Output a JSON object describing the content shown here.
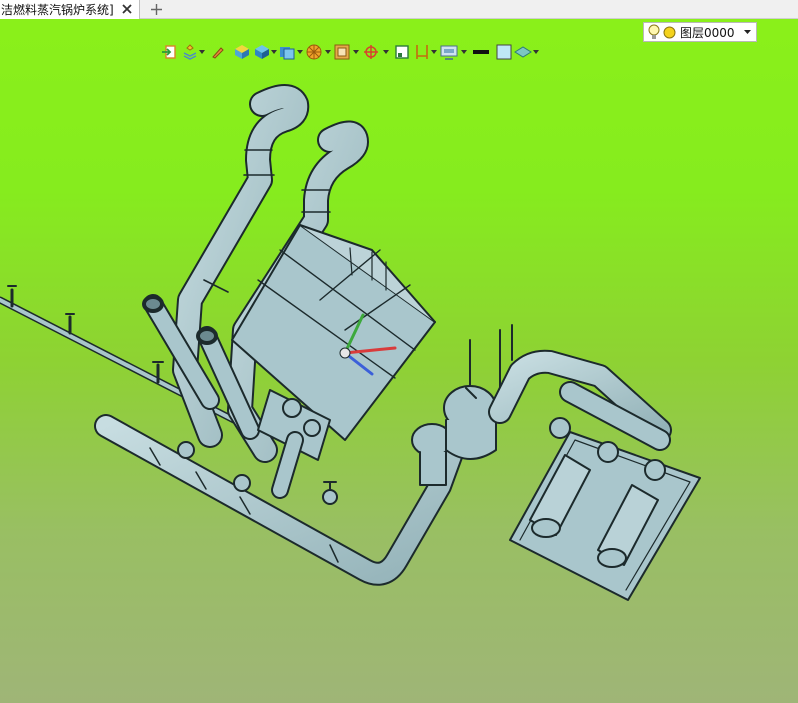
{
  "tab": {
    "title": "洁燃料蒸汽锅炉系统]",
    "close_icon": "close-icon",
    "add_icon": "plus-icon"
  },
  "toolbar": {
    "items": [
      "exit-icon",
      "layer-tools-icon",
      "pencil-icon",
      "material-icon",
      "cube-icon",
      "solid-view-icon",
      "render-icon",
      "box-frame-icon",
      "axis-icon",
      "select-box-icon",
      "dimension-icon",
      "display-icon",
      "line-style-icon",
      "color-swatch-icon",
      "surface-icon"
    ],
    "line_color": "#111111",
    "swatch_color": "#bfe8f6"
  },
  "layer": {
    "name": "图层0000",
    "bulb_icon": "lightbulb-icon",
    "dot_icon": "yellow-circle-icon",
    "dropdown_icon": "caret-down-icon"
  },
  "colors": {
    "model": "#a9c6cc",
    "outline": "#1c2a2c",
    "bg_top": "#8af01a",
    "bg_bottom": "#9fb577"
  }
}
